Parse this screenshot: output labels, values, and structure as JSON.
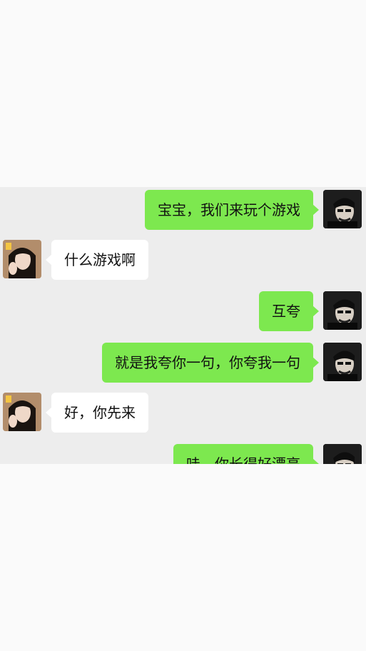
{
  "chat": {
    "messages": [
      {
        "side": "sent",
        "text": "宝宝，我们来玩个游戏"
      },
      {
        "side": "received",
        "text": "什么游戏啊"
      },
      {
        "side": "sent",
        "text": "互夸"
      },
      {
        "side": "sent",
        "text": "就是我夸你一句，你夸我一句"
      },
      {
        "side": "received",
        "text": "好，你先来"
      },
      {
        "side": "sent",
        "text": "哇，你长得好漂亮"
      }
    ]
  },
  "colors": {
    "sent_bubble": "#7de84f",
    "received_bubble": "#ffffff",
    "chat_background": "#ededed",
    "page_background": "#fafafa"
  }
}
